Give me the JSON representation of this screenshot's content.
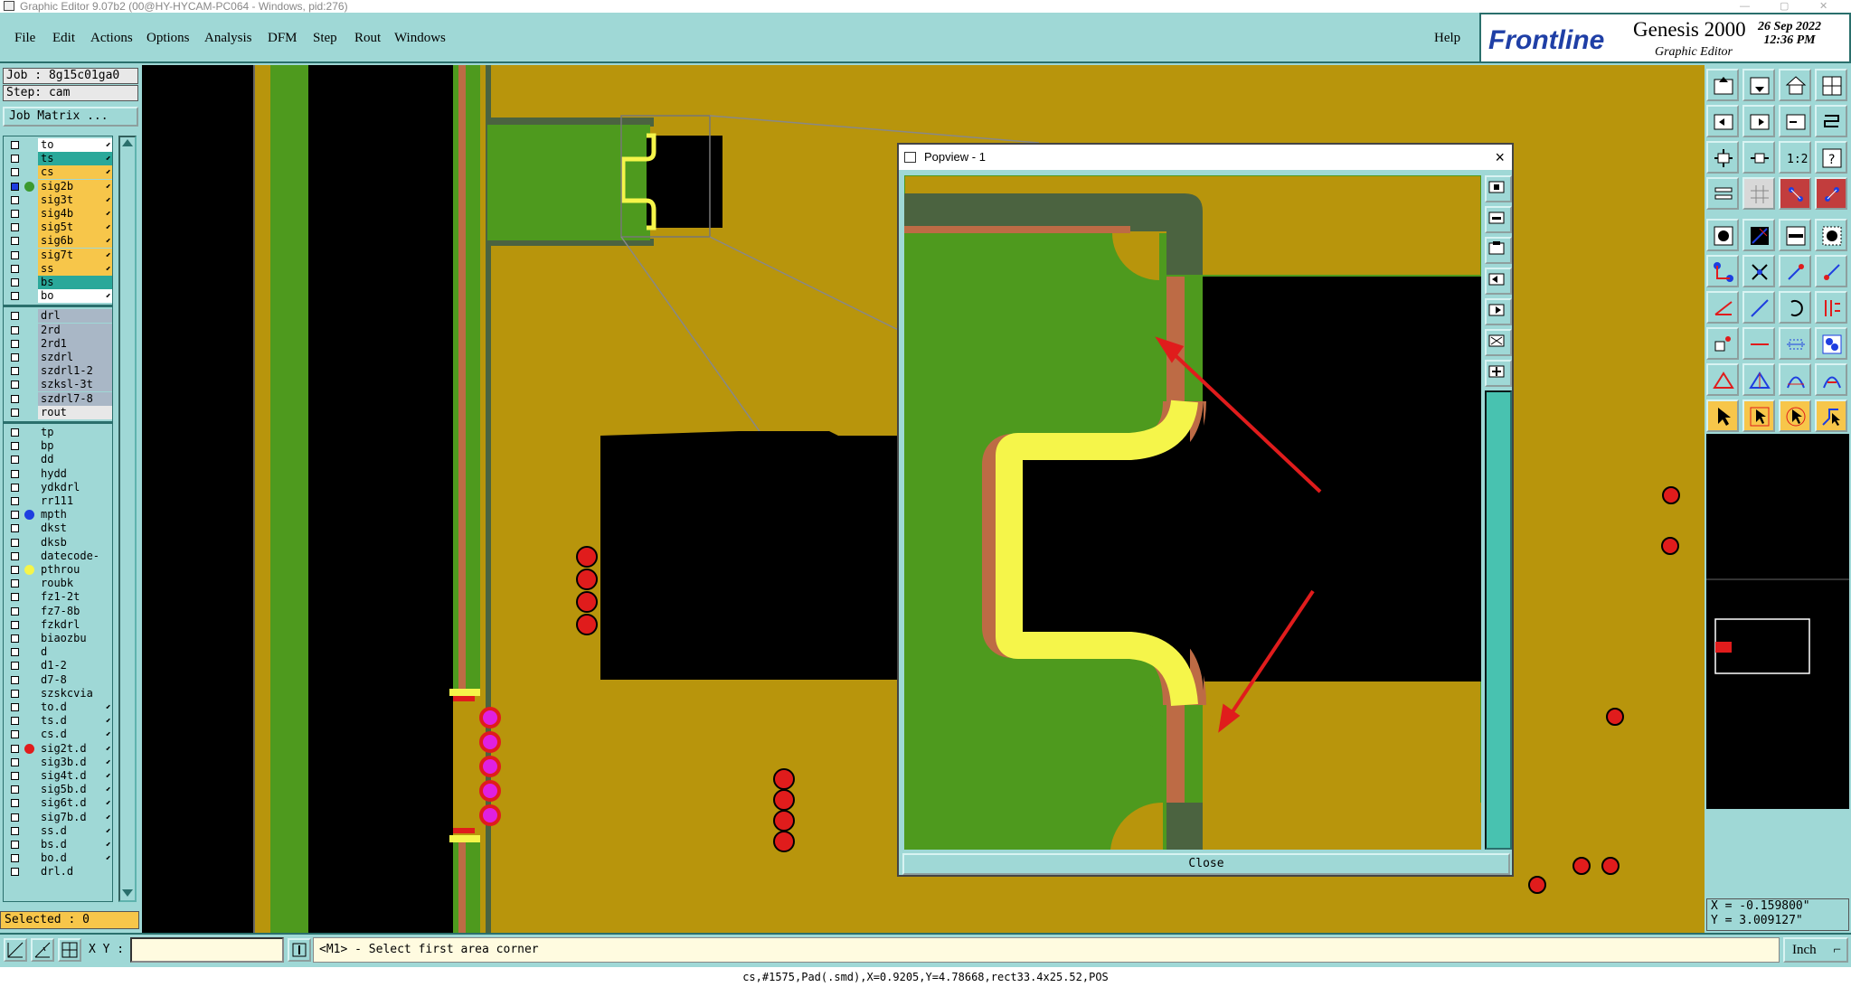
{
  "window": {
    "title": "Graphic Editor 9.07b2 (00@HY-HYCAM-PC064 - Windows, pid:276)"
  },
  "menubar": {
    "items": [
      "File",
      "Edit",
      "Actions",
      "Options",
      "Analysis",
      "DFM",
      "Step",
      "Rout",
      "Windows"
    ],
    "help": "Help"
  },
  "brand": {
    "logo": "Frontline",
    "product": "Genesis 2000",
    "subtitle": "Graphic Editor",
    "date": "26 Sep 2022",
    "time": "12:36 PM"
  },
  "job": {
    "job_label": "Job : 8g15c01ga0",
    "step_label": "Step: cam",
    "matrix_button": "Job Matrix ..."
  },
  "layers": [
    {
      "name": "to",
      "color": "#ffffff",
      "edit": true,
      "dot": ""
    },
    {
      "name": "ts",
      "color": "#2aa89a",
      "edit": true,
      "dot": ""
    },
    {
      "name": "cs",
      "color": "#f7c64a",
      "edit": true,
      "dot": ""
    },
    {
      "name": "sig2b",
      "color": "#f7c64a",
      "edit": true,
      "dot": "#3c9a2f",
      "active": true
    },
    {
      "name": "sig3t",
      "color": "#f7c64a",
      "edit": true,
      "dot": ""
    },
    {
      "name": "sig4b",
      "color": "#f7c64a",
      "edit": true,
      "dot": ""
    },
    {
      "name": "sig5t",
      "color": "#f7c64a",
      "edit": true,
      "dot": ""
    },
    {
      "name": "sig6b",
      "color": "#f7c64a",
      "edit": true,
      "dot": ""
    },
    {
      "name": "sig7t",
      "color": "#f7c64a",
      "edit": true,
      "dot": ""
    },
    {
      "name": "ss",
      "color": "#f7c64a",
      "edit": true,
      "dot": ""
    },
    {
      "name": "bs",
      "color": "#2aa89a",
      "edit": false,
      "dot": ""
    },
    {
      "name": "bo",
      "color": "#ffffff",
      "edit": true,
      "dot": ""
    },
    {
      "sep": true
    },
    {
      "name": "drl",
      "color": "#a9b7c6",
      "edit": false,
      "dot": ""
    },
    {
      "name": "2rd",
      "color": "#a9b7c6",
      "edit": false,
      "dot": ""
    },
    {
      "name": "2rd1",
      "color": "#a9b7c6",
      "edit": false,
      "dot": ""
    },
    {
      "name": "szdrl",
      "color": "#a9b7c6",
      "edit": false,
      "dot": ""
    },
    {
      "name": "szdrl1-2",
      "color": "#a9b7c6",
      "edit": false,
      "dot": ""
    },
    {
      "name": "szksl-3t",
      "color": "#a9b7c6",
      "edit": false,
      "dot": ""
    },
    {
      "name": "szdrl7-8",
      "color": "#a9b7c6",
      "edit": false,
      "dot": ""
    },
    {
      "name": "rout",
      "color": "#e8e8e8",
      "edit": false,
      "dot": ""
    },
    {
      "sep": true
    },
    {
      "name": "tp",
      "color": "#9fd8d6",
      "edit": false,
      "dot": ""
    },
    {
      "name": "bp",
      "color": "#9fd8d6",
      "edit": false,
      "dot": ""
    },
    {
      "name": "dd",
      "color": "#9fd8d6",
      "edit": false,
      "dot": ""
    },
    {
      "name": "hydd",
      "color": "#9fd8d6",
      "edit": false,
      "dot": ""
    },
    {
      "name": "ydkdrl",
      "color": "#9fd8d6",
      "edit": false,
      "dot": ""
    },
    {
      "name": "rr111",
      "color": "#9fd8d6",
      "edit": false,
      "dot": ""
    },
    {
      "name": "mpth",
      "color": "#9fd8d6",
      "edit": false,
      "dot": "#1e3ee0"
    },
    {
      "name": "dkst",
      "color": "#9fd8d6",
      "edit": false,
      "dot": ""
    },
    {
      "name": "dksb",
      "color": "#9fd8d6",
      "edit": false,
      "dot": ""
    },
    {
      "name": "datecode-pth",
      "color": "#9fd8d6",
      "edit": false,
      "dot": ""
    },
    {
      "name": "pthrou",
      "color": "#9fd8d6",
      "edit": false,
      "dot": "#f5f54a"
    },
    {
      "name": "roubk",
      "color": "#9fd8d6",
      "edit": false,
      "dot": ""
    },
    {
      "name": "fz1-2t",
      "color": "#9fd8d6",
      "edit": false,
      "dot": ""
    },
    {
      "name": "fz7-8b",
      "color": "#9fd8d6",
      "edit": false,
      "dot": ""
    },
    {
      "name": "fzkdrl",
      "color": "#9fd8d6",
      "edit": false,
      "dot": ""
    },
    {
      "name": "biaozbu",
      "color": "#9fd8d6",
      "edit": false,
      "dot": ""
    },
    {
      "name": "d",
      "color": "#9fd8d6",
      "edit": false,
      "dot": ""
    },
    {
      "name": "d1-2",
      "color": "#9fd8d6",
      "edit": false,
      "dot": ""
    },
    {
      "name": "d7-8",
      "color": "#9fd8d6",
      "edit": false,
      "dot": ""
    },
    {
      "name": "szskcvia",
      "color": "#9fd8d6",
      "edit": false,
      "dot": ""
    },
    {
      "name": "to.d",
      "color": "#9fd8d6",
      "edit": true,
      "dot": ""
    },
    {
      "name": "ts.d",
      "color": "#9fd8d6",
      "edit": true,
      "dot": ""
    },
    {
      "name": "cs.d",
      "color": "#9fd8d6",
      "edit": true,
      "dot": ""
    },
    {
      "name": "sig2t.d",
      "color": "#9fd8d6",
      "edit": true,
      "dot": "#e01c1c"
    },
    {
      "name": "sig3b.d",
      "color": "#9fd8d6",
      "edit": true,
      "dot": ""
    },
    {
      "name": "sig4t.d",
      "color": "#9fd8d6",
      "edit": true,
      "dot": ""
    },
    {
      "name": "sig5b.d",
      "color": "#9fd8d6",
      "edit": true,
      "dot": ""
    },
    {
      "name": "sig6t.d",
      "color": "#9fd8d6",
      "edit": true,
      "dot": ""
    },
    {
      "name": "sig7b.d",
      "color": "#9fd8d6",
      "edit": true,
      "dot": ""
    },
    {
      "name": "ss.d",
      "color": "#9fd8d6",
      "edit": true,
      "dot": ""
    },
    {
      "name": "bs.d",
      "color": "#9fd8d6",
      "edit": true,
      "dot": ""
    },
    {
      "name": "bo.d",
      "color": "#9fd8d6",
      "edit": true,
      "dot": ""
    },
    {
      "name": "drl.d",
      "color": "#9fd8d6",
      "edit": false,
      "dot": ""
    }
  ],
  "selected": {
    "label": "Selected : 0"
  },
  "popview": {
    "title": "Popview - 1",
    "close_label": "Close"
  },
  "coords": {
    "x": "X = -0.159800\"",
    "y": "Y = 3.009127\""
  },
  "bottom": {
    "xy_label": "X Y :",
    "xy_value": "",
    "prompt": "<M1> - Select first area corner",
    "units": "Inch"
  },
  "status": {
    "text": "cs,#1575,Pad(.smd),X=0.9205,Y=4.78668,rect33.4x25.52,POS"
  },
  "colors": {
    "panel": "#9fd8d6",
    "board": "#b8950c",
    "copper": "#4e9a1e",
    "pad": "#bd6b45",
    "highlight": "#f5f54a",
    "drill": "#e01c1c",
    "via_magenta": "#e020e0",
    "accent": "#1f3fa6"
  }
}
